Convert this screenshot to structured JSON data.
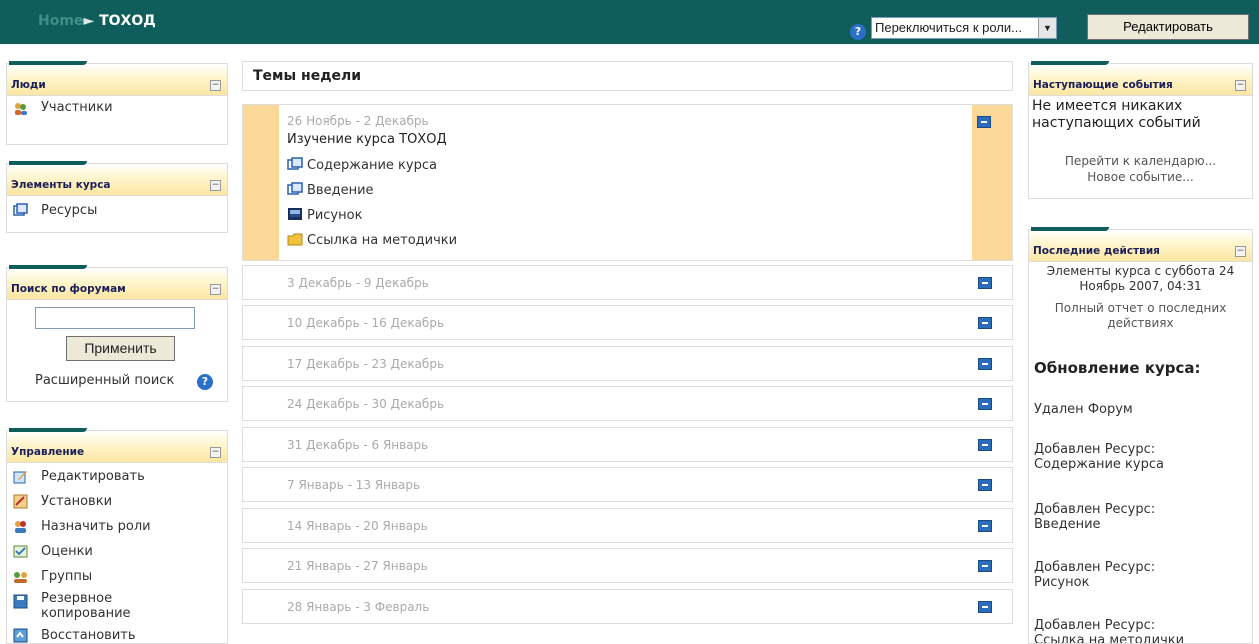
{
  "navbar": {
    "home_label": "Home",
    "course": "ТОХОД",
    "role_select_value": "Переключиться к роли...",
    "edit_button": "Редактировать"
  },
  "people_block": {
    "title": "Люди",
    "items": [
      "Участники"
    ]
  },
  "activities_block": {
    "title": "Элементы курса",
    "items": [
      "Ресурсы"
    ]
  },
  "forum_search_block": {
    "title": "Поиск по форумам",
    "input_value": "",
    "apply_button": "Применить",
    "advanced_search": "Расширенный поиск"
  },
  "admin_block": {
    "title": "Управление",
    "items": [
      "Редактировать",
      "Установки",
      "Назначить роли",
      "Оценки",
      "Группы",
      "Резервное копирование",
      "Восстановить"
    ]
  },
  "weeks": {
    "header": "Темы недели",
    "current": {
      "dates": "26 Ноябрь - 2 Декабрь",
      "title": "Изучение курса ТОХОД",
      "resources": [
        "Содержание курса",
        "Введение",
        "Рисунок",
        "Ссылка на методички"
      ]
    },
    "rows": [
      "3 Декабрь - 9 Декабрь",
      "10 Декабрь - 16 Декабрь",
      "17 Декабрь - 23 Декабрь",
      "24 Декабрь - 30 Декабрь",
      "31 Декабрь - 6 Январь",
      "7 Январь - 13 Январь",
      "14 Январь - 20 Январь",
      "21 Январь - 27 Январь",
      "28 Январь - 3 Февраль"
    ]
  },
  "upcoming_block": {
    "title": "Наступающие события",
    "text": "Не имеется никаких наступающих событий",
    "calendar_link": "Перейти к календарю...",
    "new_event_link": "Новое событие..."
  },
  "recent_block": {
    "title": "Последние действия",
    "since": "Элементы курса с суббота 24 Ноябрь 2007, 04:31",
    "full_report": "Полный отчет о последних действиях",
    "updates_heading": "Обновление курса:",
    "updates": [
      "Удален Форум",
      "Добавлен Ресурс: Содержание курса",
      "Добавлен Ресурс: Введение",
      "Добавлен Ресурс: Рисунок",
      "Добавлен Ресурс: Ссылка на методички"
    ]
  }
}
